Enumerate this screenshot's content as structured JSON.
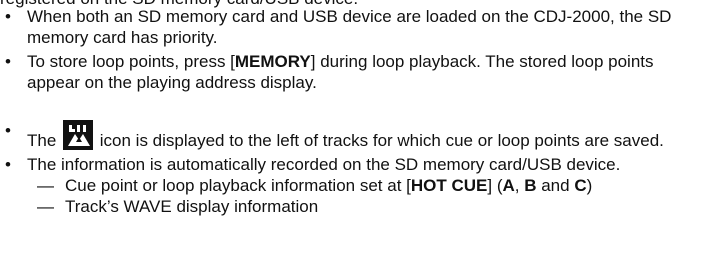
{
  "header_clipped": "registered on the SD memory card/USB device.",
  "bullet_symbol": "•",
  "dash_symbol": "—",
  "items": [
    {
      "text": "When both an SD memory card and USB device are loaded on the CDJ-2000, the SD memory card has priority."
    },
    {
      "parts": {
        "a": "To store loop points, press [",
        "b": "MEMORY",
        "c": "] during loop playback. The stored loop points appear on the playing address display."
      }
    },
    {
      "icon": "cue-loop-saved-icon",
      "parts": {
        "a": "The",
        "c": "icon is displayed to the left of tracks for which cue or loop points are saved."
      }
    },
    {
      "text": "The information is automatically recorded on the SD memory card/USB device.",
      "sub_items": [
        {
          "parts": {
            "a": "Cue point or loop playback information set at [",
            "b": "HOT CUE",
            "c": "] (",
            "d": "A",
            "e": ", ",
            "f": "B",
            "g": " and ",
            "h": "C",
            "i": ")"
          }
        },
        {
          "text": "Track’s WAVE display information"
        }
      ]
    }
  ]
}
